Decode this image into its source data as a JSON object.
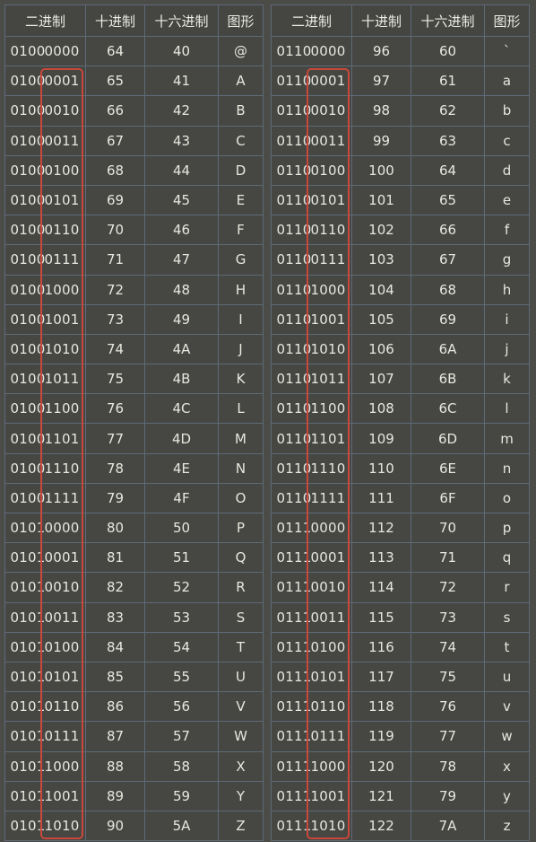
{
  "headers": [
    "二进制",
    "十进制",
    "十六进制",
    "图形"
  ],
  "left_rows": [
    {
      "hi": "0100",
      "lo": "0000",
      "dec": "64",
      "hex": "40",
      "ch": "@"
    },
    {
      "hi": "0100",
      "lo": "0001",
      "dec": "65",
      "hex": "41",
      "ch": "A"
    },
    {
      "hi": "0100",
      "lo": "0010",
      "dec": "66",
      "hex": "42",
      "ch": "B"
    },
    {
      "hi": "0100",
      "lo": "0011",
      "dec": "67",
      "hex": "43",
      "ch": "C"
    },
    {
      "hi": "0100",
      "lo": "0100",
      "dec": "68",
      "hex": "44",
      "ch": "D"
    },
    {
      "hi": "0100",
      "lo": "0101",
      "dec": "69",
      "hex": "45",
      "ch": "E"
    },
    {
      "hi": "0100",
      "lo": "0110",
      "dec": "70",
      "hex": "46",
      "ch": "F"
    },
    {
      "hi": "0100",
      "lo": "0111",
      "dec": "71",
      "hex": "47",
      "ch": "G"
    },
    {
      "hi": "0100",
      "lo": "1000",
      "dec": "72",
      "hex": "48",
      "ch": "H"
    },
    {
      "hi": "0100",
      "lo": "1001",
      "dec": "73",
      "hex": "49",
      "ch": "I"
    },
    {
      "hi": "0100",
      "lo": "1010",
      "dec": "74",
      "hex": "4A",
      "ch": "J"
    },
    {
      "hi": "0100",
      "lo": "1011",
      "dec": "75",
      "hex": "4B",
      "ch": "K"
    },
    {
      "hi": "0100",
      "lo": "1100",
      "dec": "76",
      "hex": "4C",
      "ch": "L"
    },
    {
      "hi": "0100",
      "lo": "1101",
      "dec": "77",
      "hex": "4D",
      "ch": "M"
    },
    {
      "hi": "0100",
      "lo": "1110",
      "dec": "78",
      "hex": "4E",
      "ch": "N"
    },
    {
      "hi": "0100",
      "lo": "1111",
      "dec": "79",
      "hex": "4F",
      "ch": "O"
    },
    {
      "hi": "0101",
      "lo": "0000",
      "dec": "80",
      "hex": "50",
      "ch": "P"
    },
    {
      "hi": "0101",
      "lo": "0001",
      "dec": "81",
      "hex": "51",
      "ch": "Q"
    },
    {
      "hi": "0101",
      "lo": "0010",
      "dec": "82",
      "hex": "52",
      "ch": "R"
    },
    {
      "hi": "0101",
      "lo": "0011",
      "dec": "83",
      "hex": "53",
      "ch": "S"
    },
    {
      "hi": "0101",
      "lo": "0100",
      "dec": "84",
      "hex": "54",
      "ch": "T"
    },
    {
      "hi": "0101",
      "lo": "0101",
      "dec": "85",
      "hex": "55",
      "ch": "U"
    },
    {
      "hi": "0101",
      "lo": "0110",
      "dec": "86",
      "hex": "56",
      "ch": "V"
    },
    {
      "hi": "0101",
      "lo": "0111",
      "dec": "87",
      "hex": "57",
      "ch": "W"
    },
    {
      "hi": "0101",
      "lo": "1000",
      "dec": "88",
      "hex": "58",
      "ch": "X"
    },
    {
      "hi": "0101",
      "lo": "1001",
      "dec": "89",
      "hex": "59",
      "ch": "Y"
    },
    {
      "hi": "0101",
      "lo": "1010",
      "dec": "90",
      "hex": "5A",
      "ch": "Z"
    }
  ],
  "right_rows": [
    {
      "hi": "0110",
      "lo": "0000",
      "dec": "96",
      "hex": "60",
      "ch": "`"
    },
    {
      "hi": "0110",
      "lo": "0001",
      "dec": "97",
      "hex": "61",
      "ch": "a"
    },
    {
      "hi": "0110",
      "lo": "0010",
      "dec": "98",
      "hex": "62",
      "ch": "b"
    },
    {
      "hi": "0110",
      "lo": "0011",
      "dec": "99",
      "hex": "63",
      "ch": "c"
    },
    {
      "hi": "0110",
      "lo": "0100",
      "dec": "100",
      "hex": "64",
      "ch": "d"
    },
    {
      "hi": "0110",
      "lo": "0101",
      "dec": "101",
      "hex": "65",
      "ch": "e"
    },
    {
      "hi": "0110",
      "lo": "0110",
      "dec": "102",
      "hex": "66",
      "ch": "f"
    },
    {
      "hi": "0110",
      "lo": "0111",
      "dec": "103",
      "hex": "67",
      "ch": "g"
    },
    {
      "hi": "0110",
      "lo": "1000",
      "dec": "104",
      "hex": "68",
      "ch": "h"
    },
    {
      "hi": "0110",
      "lo": "1001",
      "dec": "105",
      "hex": "69",
      "ch": "i"
    },
    {
      "hi": "0110",
      "lo": "1010",
      "dec": "106",
      "hex": "6A",
      "ch": "j"
    },
    {
      "hi": "0110",
      "lo": "1011",
      "dec": "107",
      "hex": "6B",
      "ch": "k"
    },
    {
      "hi": "0110",
      "lo": "1100",
      "dec": "108",
      "hex": "6C",
      "ch": "l"
    },
    {
      "hi": "0110",
      "lo": "1101",
      "dec": "109",
      "hex": "6D",
      "ch": "m"
    },
    {
      "hi": "0110",
      "lo": "1110",
      "dec": "110",
      "hex": "6E",
      "ch": "n"
    },
    {
      "hi": "0110",
      "lo": "1111",
      "dec": "111",
      "hex": "6F",
      "ch": "o"
    },
    {
      "hi": "0111",
      "lo": "0000",
      "dec": "112",
      "hex": "70",
      "ch": "p"
    },
    {
      "hi": "0111",
      "lo": "0001",
      "dec": "113",
      "hex": "71",
      "ch": "q"
    },
    {
      "hi": "0111",
      "lo": "0010",
      "dec": "114",
      "hex": "72",
      "ch": "r"
    },
    {
      "hi": "0111",
      "lo": "0011",
      "dec": "115",
      "hex": "73",
      "ch": "s"
    },
    {
      "hi": "0111",
      "lo": "0100",
      "dec": "116",
      "hex": "74",
      "ch": "t"
    },
    {
      "hi": "0111",
      "lo": "0101",
      "dec": "117",
      "hex": "75",
      "ch": "u"
    },
    {
      "hi": "0111",
      "lo": "0110",
      "dec": "118",
      "hex": "76",
      "ch": "v"
    },
    {
      "hi": "0111",
      "lo": "0111",
      "dec": "119",
      "hex": "77",
      "ch": "w"
    },
    {
      "hi": "0111",
      "lo": "1000",
      "dec": "120",
      "hex": "78",
      "ch": "x"
    },
    {
      "hi": "0111",
      "lo": "1001",
      "dec": "121",
      "hex": "79",
      "ch": "y"
    },
    {
      "hi": "0111",
      "lo": "1010",
      "dec": "122",
      "hex": "7A",
      "ch": "z"
    }
  ],
  "highlight_color": "#c9483c"
}
